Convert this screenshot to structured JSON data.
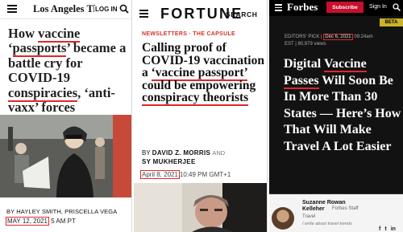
{
  "latimes": {
    "brand": "Los Angeles Times",
    "login_label": "LOG IN",
    "headline_parts": [
      "How ",
      "vaccine",
      " ‘",
      "passports",
      "’ became a battle cry for COVID-19 ",
      "conspiracies",
      ", ‘anti-vaxx’ forces"
    ],
    "byline": "BY HAYLEY SMITH, PRISCELLA VEGA",
    "date": "MAY 12, 2021",
    "time": "5 AM PT",
    "icons": [
      "menu-icon",
      "search-icon"
    ]
  },
  "fortune": {
    "brand": "FORTUNE",
    "search_label": "SEARCH",
    "kicker": "NEWSLETTERS · THE CAPSULE",
    "headline_parts": [
      "Calling proof of COVID-19 vaccination a ",
      "‘vaccine passport’",
      " could be empowering ",
      "conspiracy theorists"
    ],
    "byline_prefix": "BY",
    "author1": "DAVID Z. MORRIS",
    "and_word": "AND",
    "author2": "SY MUKHERJEE",
    "date": "April 8, 2021",
    "time": "10:49 PM GMT+1",
    "icons": [
      "menu-icon"
    ]
  },
  "forbes": {
    "brand": "Forbes",
    "subscribe_label": "Subscribe",
    "signin_label": "Sign In",
    "beta_label": "BETA",
    "meta_prefix": "EDITORS' PICK |",
    "date": "Dec 6, 2021",
    "time": "09:24am",
    "meta_line2": "EST | 80,979 views",
    "headline_parts": [
      "Digital ",
      "Vaccine Passes",
      " Will Soon Be In More Than 30 States — Here’s How That Will Make Travel A Lot Easier"
    ],
    "author_name": "Suzanne Rowan Kelleher",
    "author_role": "Forbes Staff",
    "author_topic": "Travel",
    "author_blurb": "I write about travel trends",
    "social": [
      "f",
      "t",
      "in"
    ],
    "colors": {
      "subscribe_bg": "#c8102e",
      "beta_bg": "#c9b32a"
    },
    "icons": [
      "menu-icon",
      "search-icon"
    ]
  }
}
